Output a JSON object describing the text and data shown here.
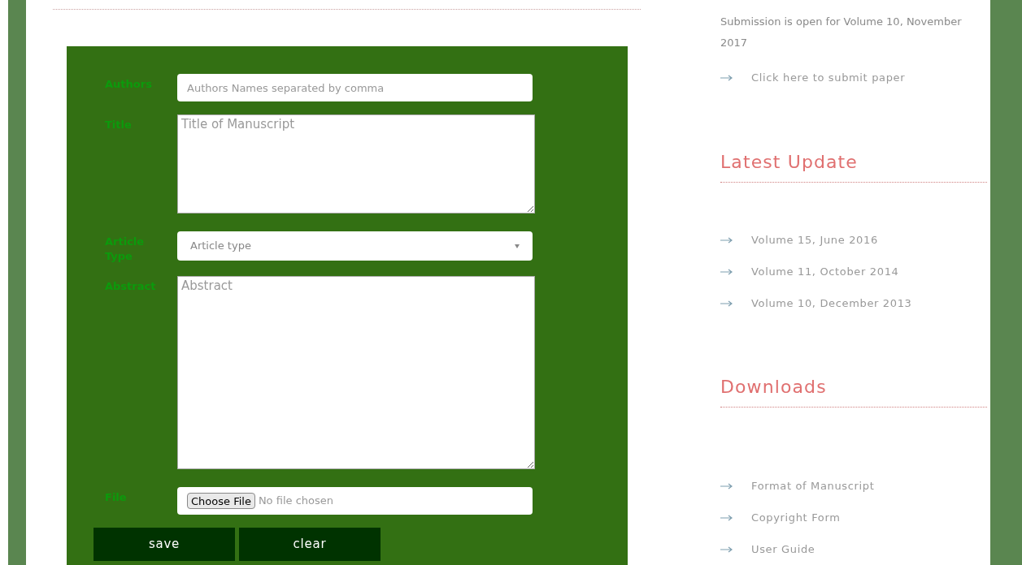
{
  "form": {
    "fields": [
      {
        "kind": "input",
        "label": "Authors",
        "placeholder": "Authors Names separated by comma"
      },
      {
        "kind": "textarea",
        "label": "Title",
        "placeholder": "Title of Manuscript"
      },
      {
        "kind": "select",
        "label": "Article Type",
        "placeholder": "Article type"
      },
      {
        "kind": "textarea_large",
        "label": "Abstract",
        "placeholder": "Abstract"
      },
      {
        "kind": "file",
        "label": "File",
        "button": "Choose File",
        "status": "No file chosen"
      }
    ],
    "buttons": [
      "save",
      "clear"
    ]
  },
  "sidebar": {
    "notice": "Submission is open for Volume 10, November 2017",
    "submit_link": "Click here to submit paper",
    "sections": [
      {
        "title": "Latest Update",
        "links": [
          "Volume 15, June 2016",
          "Volume 11, October 2014",
          "Volume 10, December 2013"
        ]
      },
      {
        "title": "Downloads",
        "links": [
          "Format of Manuscript",
          "Copyright Form",
          "User Guide"
        ]
      }
    ]
  }
}
